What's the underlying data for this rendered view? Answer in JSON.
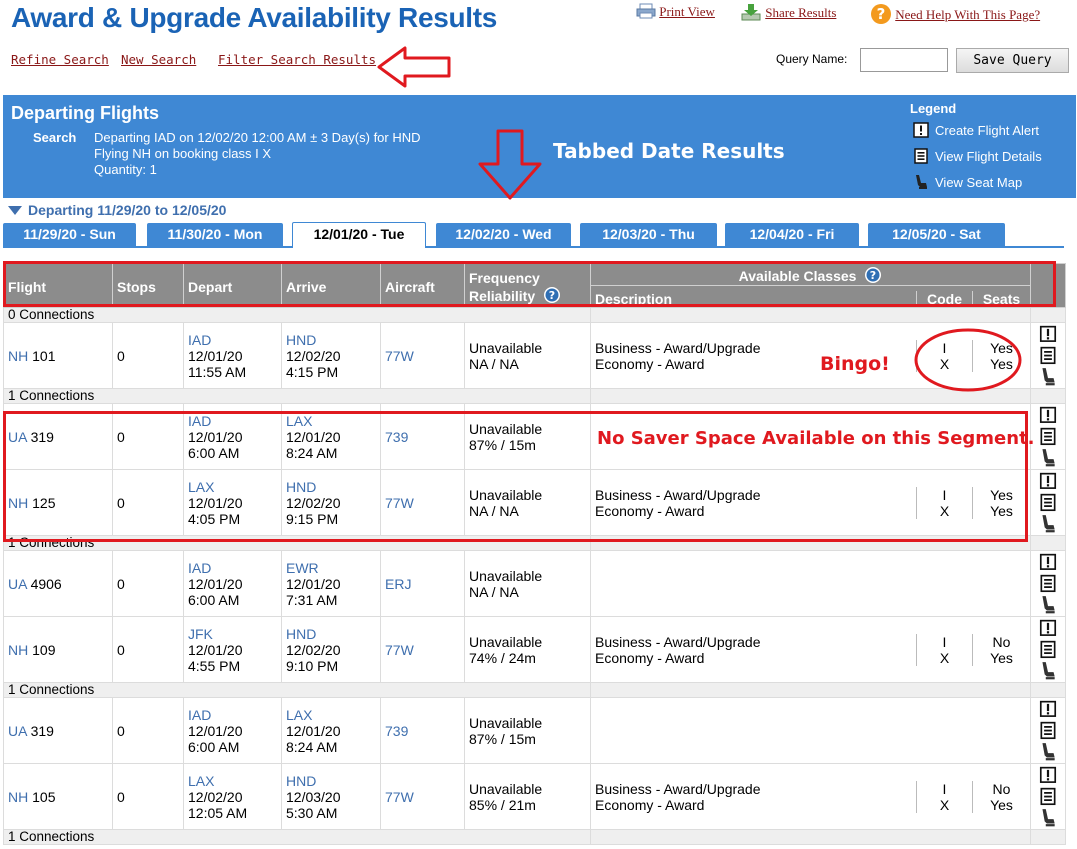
{
  "page": {
    "title": "Award & Upgrade Availability Results",
    "print_view": "Print View",
    "share_results": "Share Results",
    "need_help": "Need Help With This Page?",
    "refine_search": "Refine Search",
    "new_search": "New Search",
    "filter_results": "Filter Search Results",
    "query_name_label": "Query Name:",
    "query_name_value": "",
    "save_query": "Save Query"
  },
  "banner": {
    "title": "Departing Flights",
    "search_label": "Search",
    "search_line1": "Departing IAD on 12/02/20 12:00 AM ± 3 Day(s) for HND",
    "search_line2": "Flying NH on booking class I X",
    "search_line3": "Quantity: 1",
    "legend_title": "Legend",
    "legend": [
      "Create Flight Alert",
      "View Flight Details",
      "View Seat Map"
    ]
  },
  "annotations": {
    "tabbed": "Tabbed Date Results",
    "bingo": "Bingo!",
    "no_saver": "No Saver Space Available on this Segment."
  },
  "dates": {
    "range": "Departing 11/29/20 to 12/05/20",
    "tabs": [
      "11/29/20 - Sun",
      "11/30/20 - Mon",
      "12/01/20 - Tue",
      "12/02/20 - Wed",
      "12/03/20 - Thu",
      "12/04/20 - Fri",
      "12/05/20 - Sat"
    ],
    "active_index": 2
  },
  "table": {
    "headers": {
      "flight": "Flight",
      "stops": "Stops",
      "depart": "Depart",
      "arrive": "Arrive",
      "aircraft": "Aircraft",
      "freq1": "Frequency",
      "freq2": "Reliability",
      "available": "Available Classes",
      "description": "Description",
      "code": "Code",
      "seats": "Seats"
    },
    "connection_labels": [
      "0 Connections",
      "1 Connections",
      "1 Connections",
      "1 Connections",
      "1 Connections"
    ],
    "rows": [
      {
        "air": "NH",
        "num": "101",
        "stops": "0",
        "dep": "IAD",
        "dep_date": "12/01/20",
        "dep_time": "11:55 AM",
        "arr": "HND",
        "arr_date": "12/02/20",
        "arr_time": "4:15 PM",
        "ac": "77W",
        "f1": "Unavailable",
        "f2": "NA / NA",
        "d1": "Business - Award/Upgrade",
        "d2": "Economy - Award",
        "c1": "I",
        "c2": "X",
        "s1": "Yes",
        "s2": "Yes"
      },
      {
        "air": "UA",
        "num": "319",
        "stops": "0",
        "dep": "IAD",
        "dep_date": "12/01/20",
        "dep_time": "6:00 AM",
        "arr": "LAX",
        "arr_date": "12/01/20",
        "arr_time": "8:24 AM",
        "ac": "739",
        "f1": "Unavailable",
        "f2": "87% / 15m",
        "d1": "",
        "d2": "",
        "c1": "",
        "c2": "",
        "s1": "",
        "s2": ""
      },
      {
        "air": "NH",
        "num": "125",
        "stops": "0",
        "dep": "LAX",
        "dep_date": "12/01/20",
        "dep_time": "4:05 PM",
        "arr": "HND",
        "arr_date": "12/02/20",
        "arr_time": "9:15 PM",
        "ac": "77W",
        "f1": "Unavailable",
        "f2": "NA / NA",
        "d1": "Business - Award/Upgrade",
        "d2": "Economy - Award",
        "c1": "I",
        "c2": "X",
        "s1": "Yes",
        "s2": "Yes"
      },
      {
        "air": "UA",
        "num": "4906",
        "stops": "0",
        "dep": "IAD",
        "dep_date": "12/01/20",
        "dep_time": "6:00 AM",
        "arr": "EWR",
        "arr_date": "12/01/20",
        "arr_time": "7:31 AM",
        "ac": "ERJ",
        "f1": "Unavailable",
        "f2": "NA / NA",
        "d1": "",
        "d2": "",
        "c1": "",
        "c2": "",
        "s1": "",
        "s2": ""
      },
      {
        "air": "NH",
        "num": "109",
        "stops": "0",
        "dep": "JFK",
        "dep_date": "12/01/20",
        "dep_time": "4:55 PM",
        "arr": "HND",
        "arr_date": "12/02/20",
        "arr_time": "9:10 PM",
        "ac": "77W",
        "f1": "Unavailable",
        "f2": "74% / 24m",
        "d1": "Business - Award/Upgrade",
        "d2": "Economy - Award",
        "c1": "I",
        "c2": "X",
        "s1": "No",
        "s2": "Yes"
      },
      {
        "air": "UA",
        "num": "319",
        "stops": "0",
        "dep": "IAD",
        "dep_date": "12/01/20",
        "dep_time": "6:00 AM",
        "arr": "LAX",
        "arr_date": "12/01/20",
        "arr_time": "8:24 AM",
        "ac": "739",
        "f1": "Unavailable",
        "f2": "87% / 15m",
        "d1": "",
        "d2": "",
        "c1": "",
        "c2": "",
        "s1": "",
        "s2": ""
      },
      {
        "air": "NH",
        "num": "105",
        "stops": "0",
        "dep": "LAX",
        "dep_date": "12/02/20",
        "dep_time": "12:05 AM",
        "arr": "HND",
        "arr_date": "12/03/20",
        "arr_time": "5:30 AM",
        "ac": "77W",
        "f1": "Unavailable",
        "f2": "85% / 21m",
        "d1": "Business - Award/Upgrade",
        "d2": "Economy - Award",
        "c1": "I",
        "c2": "X",
        "s1": "No",
        "s2": "Yes"
      }
    ]
  },
  "colors": {
    "title_blue": "#1a63b5",
    "banner_blue": "#3f88d4",
    "link_red": "#8a1717",
    "annotation_red": "#e0191f",
    "header_gray": "#8c8c8c"
  }
}
